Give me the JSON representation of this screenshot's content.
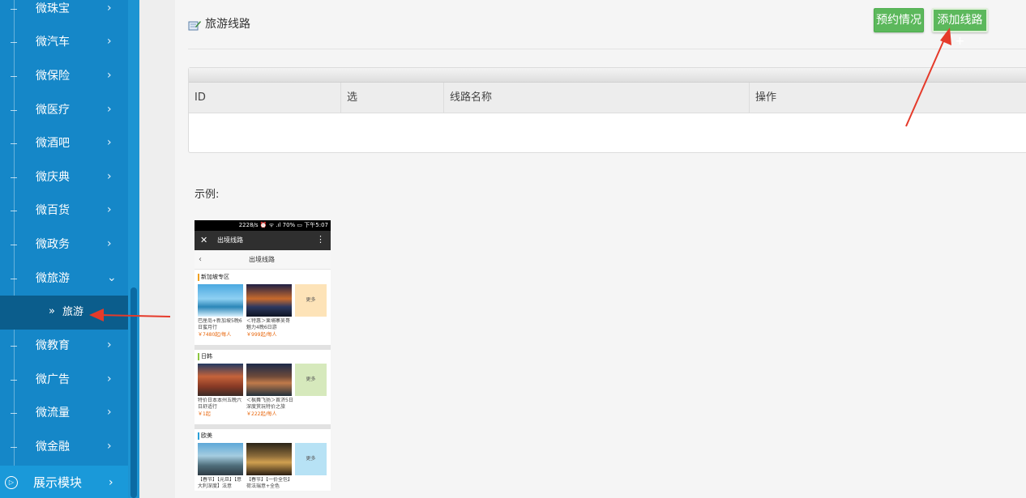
{
  "sidebar": {
    "items": [
      {
        "label": "微珠宝",
        "chevron": "›"
      },
      {
        "label": "微汽车",
        "chevron": "›"
      },
      {
        "label": "微保险",
        "chevron": "›"
      },
      {
        "label": "微医疗",
        "chevron": "›"
      },
      {
        "label": "微酒吧",
        "chevron": "›"
      },
      {
        "label": "微庆典",
        "chevron": "›"
      },
      {
        "label": "微百货",
        "chevron": "›"
      },
      {
        "label": "微政务",
        "chevron": "›"
      },
      {
        "label": "微旅游",
        "chevron": "⌄"
      },
      {
        "label": "微教育",
        "chevron": "›"
      },
      {
        "label": "微广告",
        "chevron": "›"
      },
      {
        "label": "微流量",
        "chevron": "›"
      },
      {
        "label": "微金融",
        "chevron": "›"
      }
    ],
    "sub_item": {
      "prefix": "»",
      "label": "旅游"
    },
    "bottom": {
      "label": "展示模块",
      "chevron": "›",
      "icon": "play-circle-icon"
    }
  },
  "header": {
    "title": "旅游线路",
    "booking_button": "预约情况",
    "add_button": "添加线路+"
  },
  "table": {
    "columns": [
      "ID",
      "选",
      "线路名称",
      "操作"
    ],
    "rows": []
  },
  "example": {
    "label": "示例:",
    "phone": {
      "status_bar": "2228/s ⏰ ᯤ .ıl 70% ▭ 下午5:07",
      "nav_close": "✕",
      "nav_title": "出境线路",
      "nav_menu": "⋮",
      "back": "‹",
      "page_title": "出境线路",
      "sections": [
        {
          "name": "新加坡专区",
          "accent": "#f0a020",
          "more": "更多",
          "more_bg": "#fde3b8",
          "cards": [
            {
              "caption": "巴厘岛+新加坡5晚6日蜜月行",
              "price": "￥7480起/每人"
            },
            {
              "caption": "＜特惠＞柬埔寨吴哥魅力4晚6日游",
              "price": "￥999起/每人"
            }
          ]
        },
        {
          "name": "日韩",
          "accent": "#8cc63f",
          "more": "更多",
          "more_bg": "#d6e9bc",
          "cards": [
            {
              "caption": "特价日本本州五晚六日舒适行",
              "price": "￥1起"
            },
            {
              "caption": "＜枫舞飞扬＞首济5日深度赏玩特价之旅",
              "price": "￥222起/每人"
            }
          ]
        },
        {
          "name": "欧美",
          "accent": "#2aa0d8",
          "more": "更多",
          "more_bg": "#b7e2f5",
          "cards": [
            {
              "caption": "【春节】【元旦】【意大利深度】法意",
              "price": ""
            },
            {
              "caption": "【春节】【一价全包】荷法瑞意+全色",
              "price": ""
            }
          ]
        }
      ]
    }
  },
  "colors": {
    "sidebar_bg": "#1587c8",
    "sidebar_active": "#0b5d8c",
    "button_green": "#5cb85c",
    "annotation_arrow": "#e53a2a"
  }
}
